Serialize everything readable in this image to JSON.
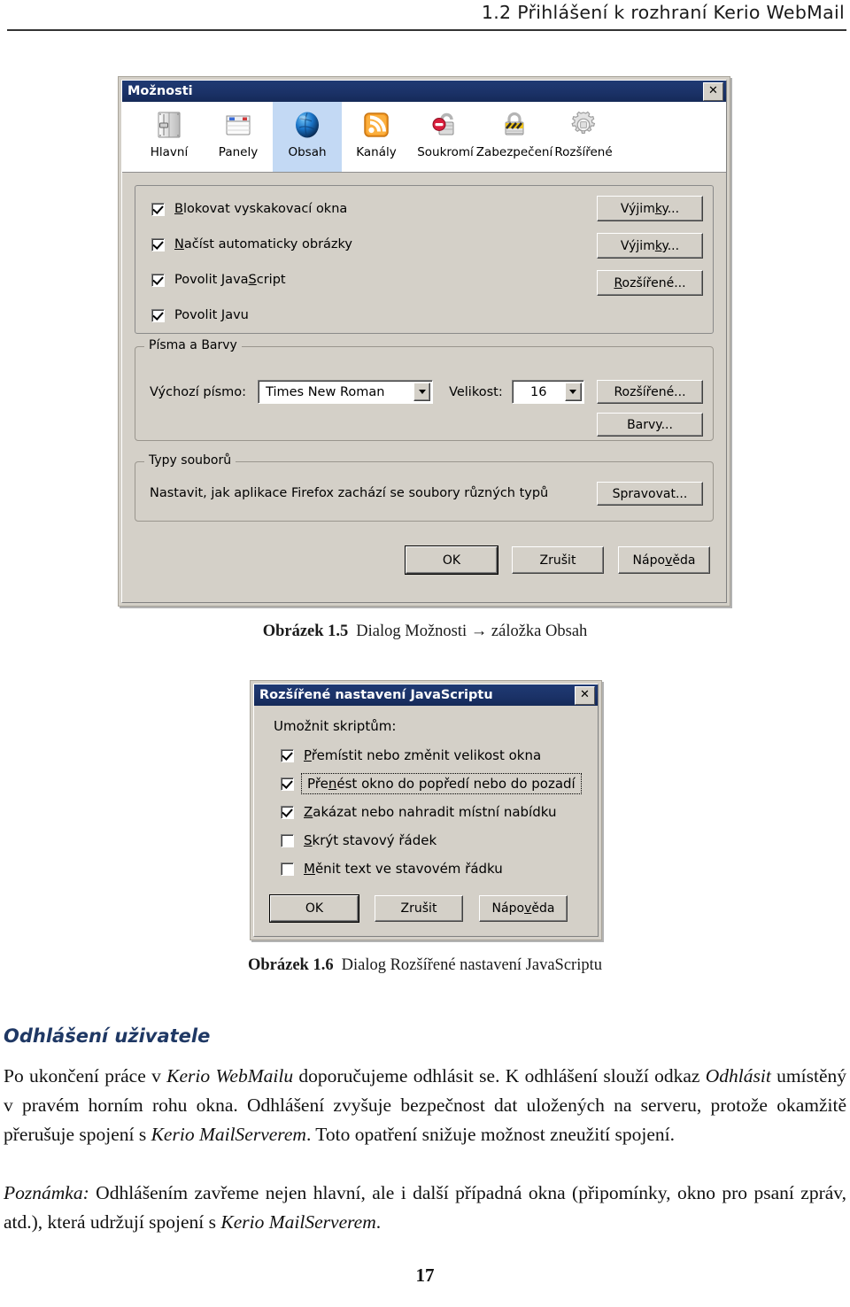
{
  "page": {
    "running_header": "1.2  Přihlášení k rozhraní Kerio WebMail",
    "page_number": "17",
    "accent_heading_color": "#1f3864",
    "titlebar_color": "#1f3a73",
    "dialog_face_color": "#d4d0c8"
  },
  "options_dialog": {
    "title": "Možnosti",
    "close_label": "✕",
    "close_icon": "close-icon",
    "toolbar": [
      {
        "label": "Hlavní",
        "icon": "sliders-icon",
        "selected": false
      },
      {
        "label": "Panely",
        "icon": "tabs-icon",
        "selected": false
      },
      {
        "label": "Obsah",
        "icon": "globe-icon",
        "selected": true
      },
      {
        "label": "Kanály",
        "icon": "rss-icon",
        "selected": false
      },
      {
        "label": "Soukromí",
        "icon": "unlock-icon",
        "selected": false
      },
      {
        "label": "Zabezpečení",
        "icon": "padlock-icon",
        "selected": false
      },
      {
        "label": "Rozšířené",
        "icon": "gear-icon",
        "selected": false
      }
    ],
    "content_checkboxes": [
      {
        "label": "Blokovat vyskakovací okna",
        "accel": "B",
        "checked": true
      },
      {
        "label": "Načíst automaticky obrázky",
        "accel": "N",
        "checked": true
      },
      {
        "label": "Povolit JavaScript",
        "accel": "S",
        "checked": true
      },
      {
        "label": "Povolit Javu",
        "accel": "J",
        "checked": true
      }
    ],
    "content_buttons": [
      {
        "label": "Výjimky...",
        "accel": "k"
      },
      {
        "label": "Výjimky...",
        "accel": "k"
      },
      {
        "label": "Rozšířené...",
        "accel": "R"
      }
    ],
    "fonts_group": {
      "legend": "Písma a Barvy",
      "default_font_label": "Výchozí písmo:",
      "default_font_accel": "p",
      "default_font_value": "Times New Roman",
      "size_label": "Velikost:",
      "size_accel": "e",
      "size_value": "16",
      "advanced_button": "Rozšířené...",
      "advanced_accel": "z",
      "colors_button": "Barvy...",
      "colors_accel": "a"
    },
    "filetypes_group": {
      "legend": "Typy souborů",
      "description": "Nastavit, jak aplikace Firefox zachází se soubory různých typů",
      "manage_button": "Spravovat...",
      "manage_accel": "S"
    },
    "footer_buttons": [
      {
        "label": "OK",
        "accel": "",
        "default": true
      },
      {
        "label": "Zrušit",
        "accel": "",
        "default": false
      },
      {
        "label": "Nápověda",
        "accel": "v",
        "default": false
      }
    ]
  },
  "figure_1_5": {
    "number": "Obrázek 1.5",
    "text": "Dialog Možnosti → záložka Obsah"
  },
  "javascript_dialog": {
    "title": "Rozšířené nastavení JavaScriptu",
    "close_label": "✕",
    "close_icon": "close-icon",
    "intro": "Umožnit skriptům:",
    "checkboxes": [
      {
        "label": "Přemístit nebo změnit velikost okna",
        "accel": "P",
        "checked": true,
        "focused": false
      },
      {
        "label": "Přenést okno do popředí nebo do pozadí",
        "accel": "n",
        "checked": true,
        "focused": true
      },
      {
        "label": "Zakázat nebo nahradit místní nabídku",
        "accel": "Z",
        "checked": true,
        "focused": false
      },
      {
        "label": "Skrýt stavový řádek",
        "accel": "S",
        "checked": false,
        "focused": false
      },
      {
        "label": "Měnit text ve stavovém řádku",
        "accel": "M",
        "checked": false,
        "focused": false
      }
    ],
    "buttons": [
      {
        "label": "OK",
        "accel": "",
        "default": true
      },
      {
        "label": "Zrušit",
        "accel": "",
        "default": false
      },
      {
        "label": "Nápověda",
        "accel": "v",
        "default": false
      }
    ]
  },
  "figure_1_6": {
    "number": "Obrázek 1.6",
    "text": "Dialog Rozšířené nastavení JavaScriptu"
  },
  "body": {
    "section_heading": "Odhlášení uživatele",
    "paragraph_1_html": "Po ukončení práce v <i>Kerio WebMailu</i> doporučujeme odhlásit se. K odhlášení slouží odkaz <i>Odhlásit</i> umístěný v pravém horním rohu okna. Odhlášení zvyšuje bezpečnost dat uložených na serveru, protože okamžitě přerušuje spojení s <i>Kerio MailServerem</i>. Toto opatření snižuje možnost zneužití spojení.",
    "paragraph_2_html": "<i>Poznámka:</i> Odhlášením zavřeme nejen hlavní, ale i další případná okna (připomínky, okno pro psaní zpráv, atd.), která udržují spojení s <i>Kerio MailServerem</i>."
  }
}
